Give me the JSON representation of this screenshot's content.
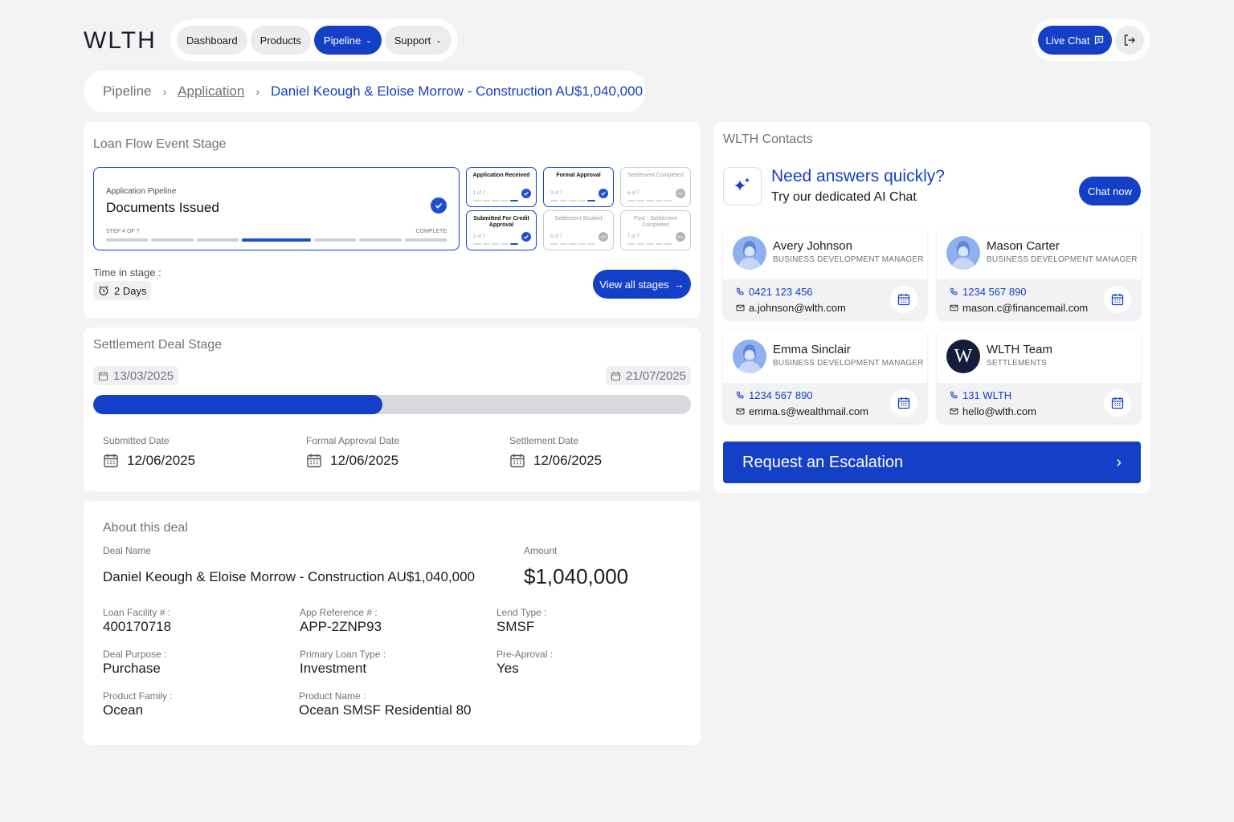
{
  "brand": {
    "logo": "WLTH",
    "accent": "#1440c8"
  },
  "nav": {
    "items": [
      {
        "label": "Dashboard"
      },
      {
        "label": "Products"
      },
      {
        "label": "Pipeline",
        "active": true
      },
      {
        "label": "Support"
      }
    ],
    "live_chat": "Live Chat"
  },
  "breadcrumb": {
    "items": [
      "Pipeline",
      "Application",
      "Daniel Keough & Eloise Morrow - Construction AU$1,040,000"
    ]
  },
  "loan_flow": {
    "title": "Loan Flow Event Stage",
    "current": {
      "caption": "Application Pipeline",
      "stage": "Documents Issued",
      "step": "STEP 4 OF 7",
      "status": "COMPLETE",
      "progress_step": 4,
      "progress_total": 7
    },
    "stages": [
      {
        "label": "Application Received",
        "count": "1 of 7",
        "done": true
      },
      {
        "label": "Formal Approval",
        "count": "3 of 7",
        "done": true
      },
      {
        "label": "Settlement Completed",
        "count": "6 of 7",
        "done": false
      },
      {
        "label": "Submitted For Credit Approval",
        "count": "2 of 7",
        "done": true
      },
      {
        "label": "Settlement Booked",
        "count": "5 of 7",
        "done": false
      },
      {
        "label": "Post - Settlement Completed",
        "count": "7 of 7",
        "done": false
      }
    ],
    "time_in_stage_label": "Time in stage :",
    "time_in_stage": "2 Days",
    "view_all": "View all stages"
  },
  "settlement": {
    "title": "Settlement Deal Stage",
    "start_date": "13/03/2025",
    "end_date": "21/07/2025",
    "progress_fraction": 0.484,
    "dates": [
      {
        "label": "Submitted Date",
        "value": "12/06/2025"
      },
      {
        "label": "Formal Approval Date",
        "value": "12/06/2025"
      },
      {
        "label": "Settlement Date",
        "value": "12/06/2025"
      }
    ]
  },
  "about": {
    "title": "About this deal",
    "deal_name_label": "Deal Name",
    "deal_name": "Daniel Keough & Eloise Morrow - Construction AU$1,040,000",
    "amount_label": "Amount",
    "amount": "$1,040,000",
    "fields": [
      {
        "label": "Loan Facility # :",
        "value": "400170718"
      },
      {
        "label": "App Reference # :",
        "value": "APP-2ZNP93"
      },
      {
        "label": "Lend Type :",
        "value": "SMSF"
      },
      {
        "label": "Deal Purpose :",
        "value": "Purchase"
      },
      {
        "label": "Primary Loan Type :",
        "value": "Investment"
      },
      {
        "label": "Pre-Aproval :",
        "value": "Yes"
      },
      {
        "label": "Product Family :",
        "value": "Ocean"
      },
      {
        "label": "Product Name :",
        "value": "Ocean SMSF Residential 80"
      }
    ]
  },
  "contacts": {
    "title": "WLTH Contacts",
    "ai_title": "Need answers quickly?",
    "ai_subtitle": "Try our dedicated AI Chat",
    "chat_now": "Chat now",
    "people": [
      {
        "name": "Avery Johnson",
        "role": "BUSINESS DEVELOPMENT MANAGER",
        "phone": "0421 123 456",
        "email": "a.johnson@wlth.com"
      },
      {
        "name": "Mason Carter",
        "role": "BUSINESS DEVELOPMENT MANAGER",
        "phone": "1234 567 890",
        "email": "mason.c@financemail.com"
      },
      {
        "name": "Emma Sinclair",
        "role": "BUSINESS DEVELOPMENT MANAGER",
        "phone": "1234 567 890",
        "email": "emma.s@wealthmail.com"
      },
      {
        "name": "WLTH Team",
        "role": "SETTLEMENTS",
        "phone": "131 WLTH",
        "email": "hello@wlth.com"
      }
    ],
    "escalation": "Request an Escalation"
  }
}
